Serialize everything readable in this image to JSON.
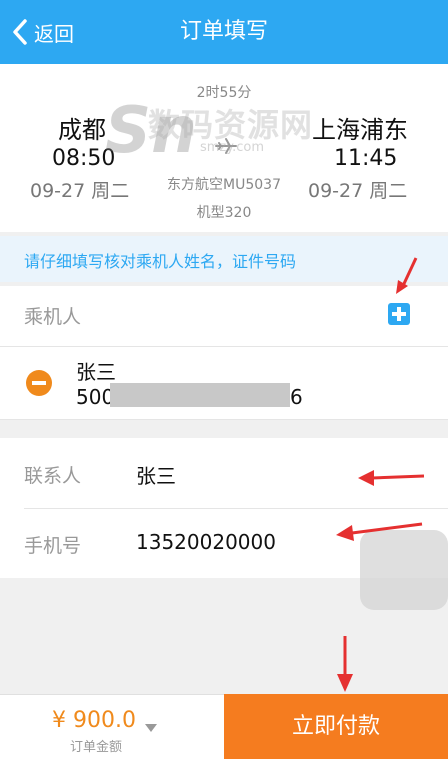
{
  "nav": {
    "back_label": "返回",
    "title": "订单填写"
  },
  "flight": {
    "dep_city": "成都",
    "dep_time": "08:50",
    "dep_date": "09-27 周二",
    "duration": "2时55分",
    "flight_no": "东方航空MU5037",
    "aircraft": "机型320",
    "arr_city": "上海浦东",
    "arr_time": "11:45",
    "arr_date": "09-27 周二"
  },
  "watermark": {
    "text": "数码资源网",
    "sub": "smzy.com"
  },
  "notice": "请仔细填写核对乘机人姓名，证件号码",
  "passenger_section": {
    "label": "乘机人"
  },
  "passenger": {
    "name": "张三",
    "id_start": "500",
    "id_end": "6"
  },
  "contact": {
    "name_label": "联系人",
    "name_value": "张三",
    "phone_label": "手机号",
    "phone_value": "13520020000"
  },
  "footer": {
    "price": "¥ 900.0",
    "price_label": "订单金额",
    "pay_label": "立即付款"
  },
  "colors": {
    "nav": "#2da8f2",
    "accent": "#f08a1c",
    "pay": "#f57c1f",
    "annotation": "#e53030"
  }
}
